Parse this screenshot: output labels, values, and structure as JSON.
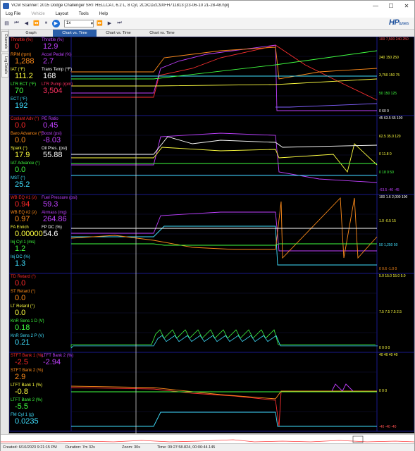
{
  "window": {
    "title": "VCM Scanner: 2015 Dodge Challenger SRT HELLCAT, 6.2 L, 8 Cyl, 2C3CDZC9XFH711813 [23-06-10 21-28-48.hpl]",
    "minimize": "—",
    "maximize": "☐",
    "close": "✕"
  },
  "menu": {
    "items": [
      "Log File",
      "Vehicle",
      "Layout",
      "Tools",
      "Help"
    ],
    "disabled": [
      "Vehicle"
    ]
  },
  "toolbar": {
    "speed": "1x"
  },
  "logo": {
    "brand": "HP",
    "sub": "tuners"
  },
  "sidetabs": [
    "Channels",
    "Log Details"
  ],
  "tabs": [
    "Graph",
    "Chart vs. Time",
    "Chart vs. Time",
    "Chart vs. Time"
  ],
  "panels": [
    {
      "rows": [
        [
          {
            "label": "Throttle (%)",
            "value": "0",
            "color": "#ff2a2a"
          },
          {
            "label": "Throttle (%)",
            "value": "12.9",
            "color": "#c040ff"
          }
        ],
        [
          {
            "label": "RPM (rpm)",
            "value": "1,288",
            "color": "#ff8c1a"
          },
          {
            "label": "Accel Pedal (%)",
            "value": "2.7",
            "color": "#c040ff"
          }
        ],
        [
          {
            "label": "IAT (°F)",
            "value": "111.2",
            "color": "#ffff40"
          },
          {
            "label": "Trans Temp (°F)",
            "value": "168",
            "color": "#ffffff"
          }
        ],
        [
          {
            "label": "LTR ECT (°F)",
            "value": "70",
            "color": "#40ff40"
          },
          {
            "label": "LTR Pump (rpm)",
            "value": "3,504",
            "color": "#ff3060"
          }
        ],
        [
          {
            "label": "ECT (°F)",
            "value": "192",
            "color": "#40e0ff"
          }
        ]
      ],
      "scales": [
        {
          "text": "100 7,500 240 250",
          "color": "#ff5050"
        },
        {
          "text": "240 150 250",
          "color": "#ffff40"
        },
        {
          "text": "3,750 150 75",
          "color": "#ffff40"
        },
        {
          "text": "50 150 125",
          "color": "#40ff40"
        },
        {
          "text": "0 60 0",
          "color": "#ffffff"
        }
      ]
    },
    {
      "rows": [
        [
          {
            "label": "Coolant Adv (°)",
            "value": "0.0",
            "color": "#ff2a2a"
          },
          {
            "label": "PE Ratio",
            "value": "0.45",
            "color": "#c040ff"
          }
        ],
        [
          {
            "label": "Baro Advance (°)",
            "value": "0.0",
            "color": "#ff8c1a"
          },
          {
            "label": "Boost (psi)",
            "value": "-8.03",
            "color": "#c040ff"
          }
        ],
        [
          {
            "label": "Spark (°)",
            "value": "17.9",
            "color": "#ffff40"
          },
          {
            "label": "Oil Pres. (psi)",
            "value": "55.88",
            "color": "#ffffff"
          }
        ],
        [
          {
            "label": "IAT Advance (°)",
            "value": "0.0",
            "color": "#40ff40"
          }
        ],
        [
          {
            "label": "MST (°)",
            "value": "25.2",
            "color": "#40e0ff"
          }
        ]
      ],
      "scales": [
        {
          "text": "45 63.5 65 100",
          "color": "#ffffff"
        },
        {
          "text": "62.5 35.0 120",
          "color": "#ffff40"
        },
        {
          "text": "0 11.8 0",
          "color": "#ffff40"
        },
        {
          "text": "0 18 0 50",
          "color": "#40ff40"
        },
        {
          "text": "-63.5 -40 -45",
          "color": "#c040ff"
        }
      ]
    },
    {
      "rows": [
        [
          {
            "label": "WB EQ #1 (λ)",
            "value": "0.94",
            "color": "#ff2a2a"
          },
          {
            "label": "Fuel Pressure (psi)",
            "value": "59.3",
            "color": "#c040ff"
          }
        ],
        [
          {
            "label": "WB EQ #2 (λ)",
            "value": "0.97",
            "color": "#ff8c1a"
          },
          {
            "label": "Airmass (mg)",
            "value": "264.86",
            "color": "#c040ff"
          }
        ],
        [
          {
            "label": "FA Enrich",
            "value": "0.00000",
            "color": "#ffff40"
          },
          {
            "label": "FP DC (%)",
            "value": "54.6",
            "color": "#ffffff"
          }
        ],
        [
          {
            "label": "Inj Cyl 1 (ms)",
            "value": "1.2",
            "color": "#40ff40"
          }
        ],
        [
          {
            "label": "Inj DC (%)",
            "value": "1.3",
            "color": "#40e0ff"
          }
        ]
      ],
      "scales": [
        {
          "text": "100 1.6 2,000 100",
          "color": "#ffffff"
        },
        {
          "text": "1.0 -0.5 15",
          "color": "#ffff40"
        },
        {
          "text": "50 1,250 50",
          "color": "#40e0ff"
        },
        {
          "text": "0 0.6 -1.0 0",
          "color": "#ff8c1a"
        }
      ]
    },
    {
      "rows": [
        [
          {
            "label": "TD Retard (°)",
            "value": "0.0",
            "color": "#ff2a2a"
          }
        ],
        [
          {
            "label": "ST Retard (°)",
            "value": "0.0",
            "color": "#ff8c1a"
          }
        ],
        [
          {
            "label": "LT Retard (°)",
            "value": "0.0",
            "color": "#ffff40"
          }
        ],
        [
          {
            "label": "KnR Sens 1 D (V)",
            "value": "0.18",
            "color": "#40ff40"
          }
        ],
        [
          {
            "label": "KnR Sens 2 P (V)",
            "value": "0.21",
            "color": "#40e0ff"
          }
        ]
      ],
      "scales": [
        {
          "text": "5.0 15.0 15.0 5.0",
          "color": "#ffff40"
        },
        {
          "text": "7.5 7.5 7.5 2.5",
          "color": "#ffff40"
        },
        {
          "text": "0 0 0 0",
          "color": "#ffff40"
        }
      ]
    },
    {
      "rows": [
        [
          {
            "label": "STFT Bank 1 (%)",
            "value": "-2.5",
            "color": "#ff2a2a"
          },
          {
            "label": "LTFT Bank 2 (%)",
            "value": "-2.94",
            "color": "#c040ff"
          }
        ],
        [
          {
            "label": "STFT Bank 2 (%)",
            "value": "2.9",
            "color": "#ff8c1a"
          }
        ],
        [
          {
            "label": "LTFT Bank 1 (%)",
            "value": "-0.8",
            "color": "#ffff40"
          }
        ],
        [
          {
            "label": "LTFT Bank 2 (%)",
            "value": "-5.5",
            "color": "#40ff40"
          }
        ],
        [
          {
            "label": "FM Cyl 1 (g)",
            "value": "0.0235",
            "color": "#40e0ff"
          }
        ]
      ],
      "scales": [
        {
          "text": "40 40 40 40",
          "color": "#ffff40"
        },
        {
          "text": "0 0 0",
          "color": "#ffff40"
        },
        {
          "text": "-40 -40 -40",
          "color": "#ff5050"
        }
      ]
    }
  ],
  "status": {
    "created": "Created: 6/10/2023 9:21:15 PM",
    "duration": "Duration: 7m 32s",
    "zoom": "Zoom: 30s",
    "time": "Time: 09:27:58.824, 00:06:44.145"
  },
  "colors": {
    "chart_bg": "#000000",
    "panel_divider": "#1a1a8c",
    "grid": "#151540",
    "cursor": "#d0d0d0",
    "active_tab": "#2b5ea8"
  }
}
